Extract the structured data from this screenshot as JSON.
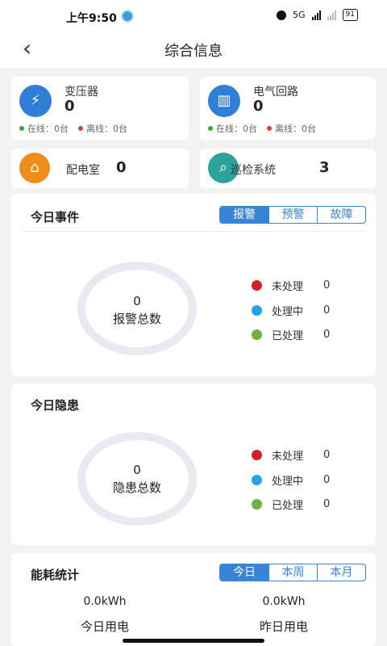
{
  "status": {
    "time": "上午9:50",
    "network": "5G",
    "battery": "91"
  },
  "nav": {
    "title": "综合信息",
    "back_icon": "chevron-left-icon"
  },
  "devices": {
    "transformer": {
      "name": "变压器",
      "count": "0",
      "online": "在线：0台",
      "offline": "离线：0台",
      "icon": "transformer-icon",
      "color": "#2f7ed8"
    },
    "circuit": {
      "name": "电气回路",
      "count": "0",
      "online": "在线：0台",
      "offline": "离线：0台",
      "icon": "circuit-icon",
      "color": "#2f7ed8"
    },
    "room": {
      "name": "配电室",
      "count": "0",
      "icon": "home-icon",
      "color": "#f08c1c"
    },
    "patrol": {
      "name": "巡检系统",
      "count": "3",
      "icon": "patrol-icon",
      "color": "#2ba39a"
    }
  },
  "events": {
    "title": "今日事件",
    "tabs": [
      "报警",
      "预警",
      "故障"
    ],
    "active_tab": "报警",
    "total_value": "0",
    "total_label": "报警总数",
    "legend": [
      {
        "label": "未处理",
        "value": "0",
        "color": "#d41f2a"
      },
      {
        "label": "处理中",
        "value": "0",
        "color": "#26a3e6"
      },
      {
        "label": "已处理",
        "value": "0",
        "color": "#6db33f"
      }
    ]
  },
  "hazards": {
    "title": "今日隐患",
    "total_value": "0",
    "total_label": "隐患总数",
    "legend": [
      {
        "label": "未处理",
        "value": "0",
        "color": "#d41f2a"
      },
      {
        "label": "处理中",
        "value": "0",
        "color": "#26a3e6"
      },
      {
        "label": "已处理",
        "value": "0",
        "color": "#6db33f"
      }
    ]
  },
  "energy": {
    "title": "能耗统计",
    "tabs": [
      "今日",
      "本周",
      "本月"
    ],
    "active_tab": "今日",
    "today_value": "0.0kWh",
    "today_label": "今日用电",
    "yesterday_value": "0.0kWh",
    "yesterday_label": "昨日用电"
  },
  "colors": {
    "accent": "#3a84d6",
    "online": "#2eaa3e",
    "offline": "#e03a3a"
  }
}
